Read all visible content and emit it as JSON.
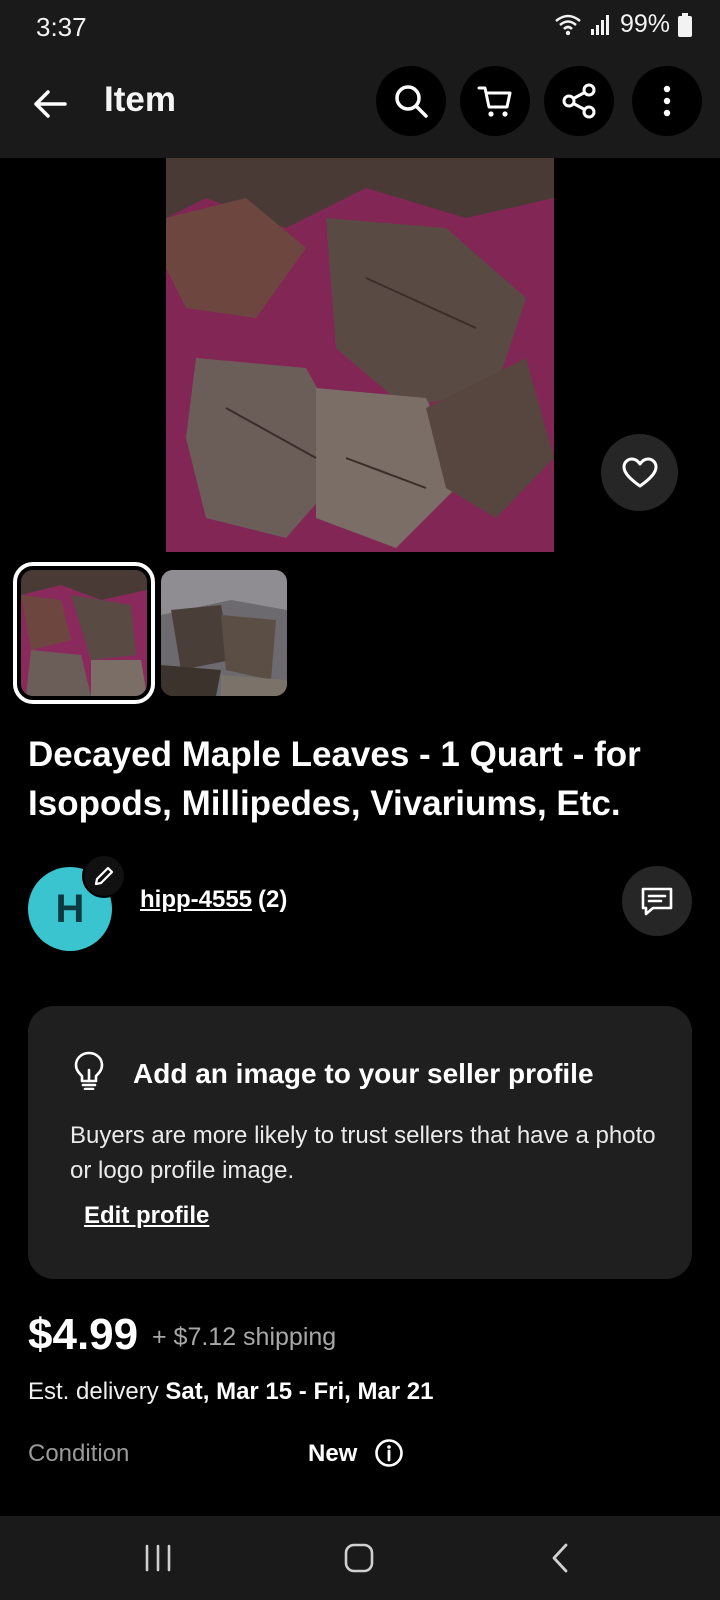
{
  "status_bar": {
    "time": "3:37",
    "battery": "99%"
  },
  "app_bar": {
    "title": "Item",
    "actions": [
      "search-icon",
      "cart-icon",
      "share-icon",
      "more-vert-icon"
    ]
  },
  "gallery": {
    "thumbnail_count": 2,
    "selected_index": 0
  },
  "listing": {
    "title": "Decayed Maple Leaves - 1 Quart - for Isopods, Millipedes, Vivariums, Etc."
  },
  "seller": {
    "avatar_letter": "H",
    "name": "hipp-4555",
    "feedback_count": "(2)"
  },
  "promo": {
    "title": "Add an image to your seller profile",
    "body": "Buyers are more likely to trust sellers that have a photo or logo profile image.",
    "link": "Edit profile"
  },
  "pricing": {
    "price": "$4.99",
    "shipping": "+ $7.12 shipping",
    "delivery_label": "Est. delivery",
    "delivery_range": "Sat, Mar 15 - Fri, Mar 21"
  },
  "details": {
    "condition_label": "Condition",
    "condition_value": "New"
  },
  "colors": {
    "avatar_bg": "#3ac4cf",
    "surface": "#1f1f1f",
    "app_bar": "#1a1a1a"
  }
}
